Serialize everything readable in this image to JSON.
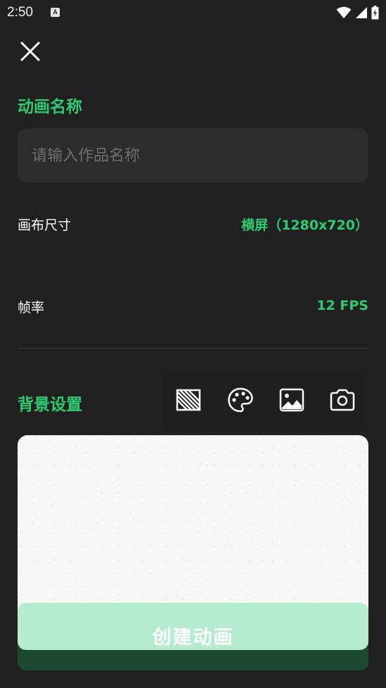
{
  "status_bar": {
    "time": "2:50",
    "notification_icon": "A"
  },
  "header": {
    "close_icon": "close-icon"
  },
  "name_section": {
    "title": "动画名称",
    "placeholder": "请输入作品名称",
    "value": ""
  },
  "canvas_size": {
    "label": "画布尺寸",
    "value": "横屏（1280x720）"
  },
  "frame_rate": {
    "label": "帧率",
    "value": "12 FPS"
  },
  "background": {
    "title": "背景设置",
    "tools": [
      "transparent-pattern-icon",
      "palette-icon",
      "image-icon",
      "camera-icon"
    ]
  },
  "create_button": {
    "label": "创建动画"
  },
  "colors": {
    "accent": "#2ecc71",
    "background": "#212121",
    "input_bg": "#2c2c2c",
    "button_bg": "#b5ebcf"
  }
}
